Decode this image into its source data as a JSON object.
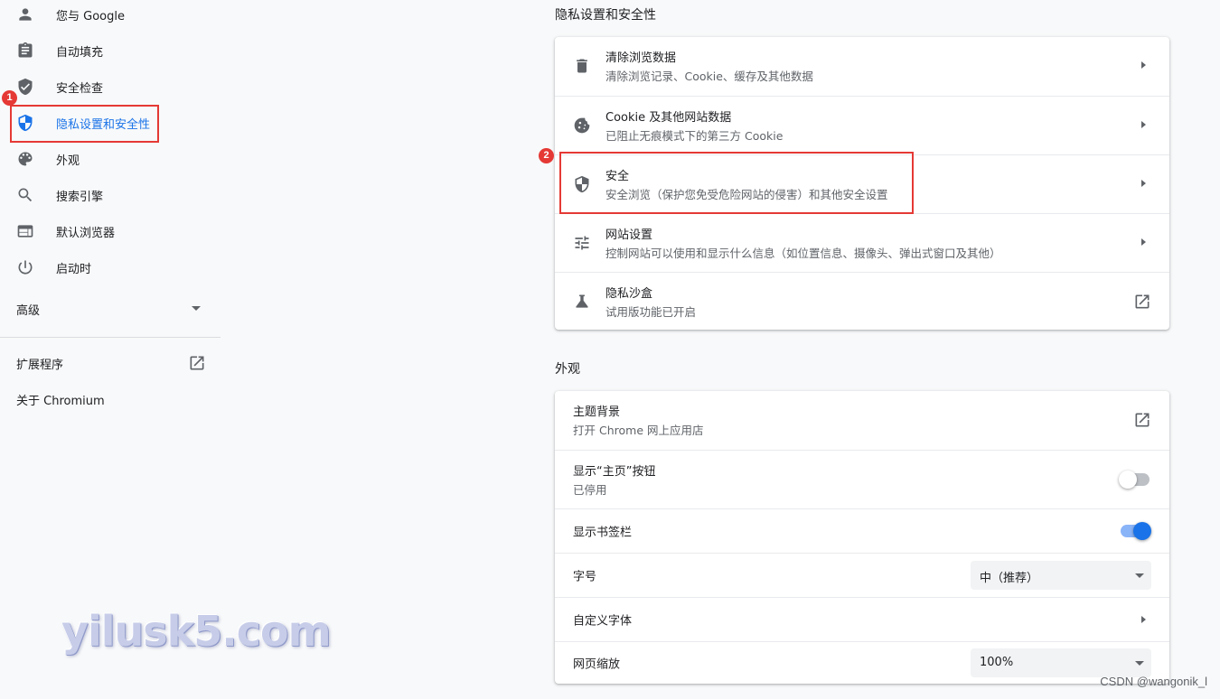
{
  "sidebar": {
    "items": [
      {
        "label": "您与 Google",
        "icon": "person-icon"
      },
      {
        "label": "自动填充",
        "icon": "clipboard-icon"
      },
      {
        "label": "安全检查",
        "icon": "shield-check-icon"
      },
      {
        "label": "隐私设置和安全性",
        "icon": "shield-half-icon",
        "active": true
      },
      {
        "label": "外观",
        "icon": "palette-icon"
      },
      {
        "label": "搜索引擎",
        "icon": "search-icon"
      },
      {
        "label": "默认浏览器",
        "icon": "browser-icon"
      },
      {
        "label": "启动时",
        "icon": "power-icon"
      }
    ],
    "advanced_label": "高级",
    "extensions_label": "扩展程序",
    "about_label": "关于 Chromium"
  },
  "annotations": {
    "badge1": "1",
    "badge2": "2"
  },
  "privacy": {
    "title": "隐私设置和安全性",
    "rows": [
      {
        "title": "清除浏览数据",
        "subtitle": "清除浏览记录、Cookie、缓存及其他数据",
        "icon": "trash-icon"
      },
      {
        "title": "Cookie 及其他网站数据",
        "subtitle": "已阻止无痕模式下的第三方 Cookie",
        "icon": "cookie-icon"
      },
      {
        "title": "安全",
        "subtitle": "安全浏览（保护您免受危险网站的侵害）和其他安全设置",
        "icon": "security-shield-icon"
      },
      {
        "title": "网站设置",
        "subtitle": "控制网站可以使用和显示什么信息（如位置信息、摄像头、弹出式窗口及其他）",
        "icon": "tune-icon"
      },
      {
        "title": "隐私沙盒",
        "subtitle": "试用版功能已开启",
        "icon": "flask-icon"
      }
    ]
  },
  "appearance": {
    "title": "外观",
    "theme_title": "主题背景",
    "theme_subtitle": "打开 Chrome 网上应用店",
    "home_title": "显示“主页”按钮",
    "home_subtitle": "已停用",
    "home_enabled": false,
    "bookmarks_title": "显示书签栏",
    "bookmarks_enabled": true,
    "fontsize_title": "字号",
    "fontsize_value": "中（推荐）",
    "customfonts_title": "自定义字体",
    "zoom_title": "网页缩放",
    "zoom_value": "100%"
  },
  "watermark": "yilusk5.com",
  "credit": "CSDN @wangonik_l",
  "colors": {
    "accent": "#1a73e8",
    "annotation": "#e53935"
  }
}
